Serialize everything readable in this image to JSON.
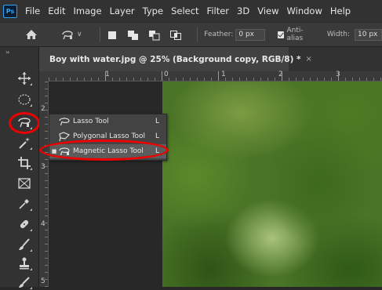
{
  "app": {
    "logo_text": "Ps"
  },
  "menubar": {
    "items": [
      "File",
      "Edit",
      "Image",
      "Layer",
      "Type",
      "Select",
      "Filter",
      "3D",
      "View",
      "Window",
      "Help"
    ]
  },
  "options_bar": {
    "feather_label": "Feather:",
    "feather_value": "0 px",
    "antialias_label": "Anti-alias",
    "antialias_checked": true,
    "width_label": "Width:",
    "width_value": "10 px"
  },
  "toolbar": {
    "collapse_glyph": "››",
    "tools": [
      "move-tool",
      "marquee-tool",
      "lasso-tool",
      "magic-wand-tool",
      "crop-tool",
      "frame-tool",
      "eyedropper-tool",
      "healing-brush-tool",
      "brush-tool",
      "clone-stamp-tool",
      "history-brush-tool"
    ]
  },
  "document": {
    "tab_title": "Boy with water.jpg @ 25% (Background copy, RGB/8) *",
    "close_glyph": "×"
  },
  "rulers": {
    "top_labels": [
      "1",
      "0",
      "1",
      "2",
      "3"
    ],
    "left_labels": [
      "2",
      "3",
      "4",
      "5"
    ]
  },
  "flyout": {
    "items": [
      {
        "label": "Lasso Tool",
        "shortcut": "L",
        "icon": "lasso-icon",
        "active": false,
        "selected": false
      },
      {
        "label": "Polygonal Lasso Tool",
        "shortcut": "L",
        "icon": "polygonal-lasso-icon",
        "active": false,
        "selected": false
      },
      {
        "label": "Magnetic Lasso Tool",
        "shortcut": "L",
        "icon": "magnetic-lasso-icon",
        "active": true,
        "selected": true
      }
    ],
    "active_bullet": "■"
  },
  "colors": {
    "annotation": "#e00000",
    "menubar_bg": "#323232",
    "options_bg": "#3a3a3a",
    "accent": "#2fa3f7"
  }
}
